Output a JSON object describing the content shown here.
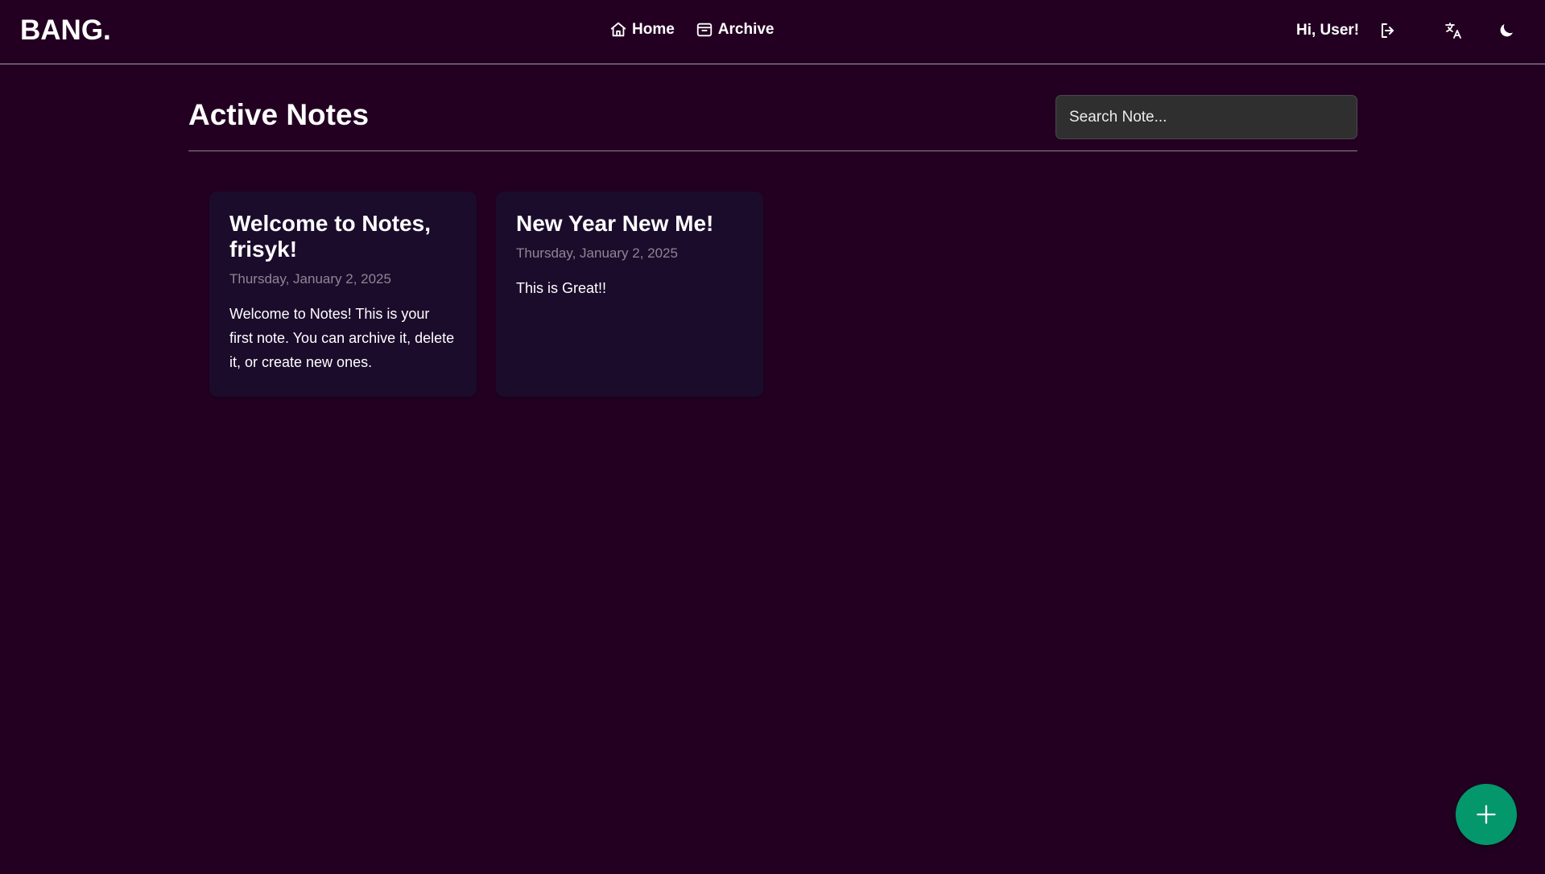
{
  "header": {
    "brand": "BANG.",
    "nav": [
      {
        "label": "Home",
        "icon": "home-icon"
      },
      {
        "label": "Archive",
        "icon": "archive-icon"
      }
    ],
    "greeting": "Hi, User!",
    "actions": {
      "logout_icon": "logout-icon",
      "translate_icon": "translate-icon",
      "theme_icon": "moon-icon"
    }
  },
  "main": {
    "title": "Active Notes",
    "search": {
      "placeholder": "Search Note...",
      "value": ""
    },
    "notes": [
      {
        "title": "Welcome to Notes, frisyk!",
        "date": "Thursday, January 2, 2025",
        "body": "Welcome to Notes! This is your first note. You can archive it, delete it, or create new ones."
      },
      {
        "title": "New Year New Me!",
        "date": "Thursday, January 2, 2025",
        "body": "This is Great!!"
      }
    ]
  },
  "fab": {
    "icon": "plus-icon"
  },
  "colors": {
    "background": "#230022",
    "card": "#1b0c2b",
    "search_bg": "#2f2f2f",
    "accent": "#04976b",
    "muted_text": "#8f8595"
  }
}
